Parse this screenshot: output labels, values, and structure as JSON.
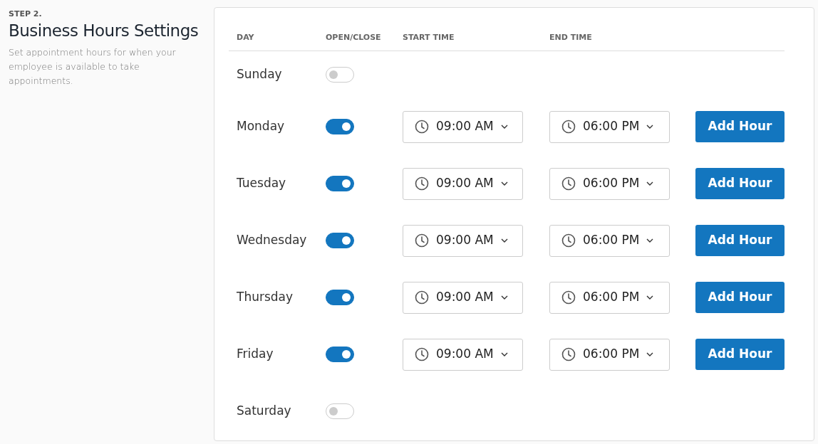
{
  "intro": {
    "step": "STEP 2.",
    "title": "Business Hours Settings",
    "description": "Set appointment hours for when your employee is available to take appointments."
  },
  "columns": [
    "DAY",
    "OPEN/CLOSE",
    "START TIME",
    "END TIME"
  ],
  "days": [
    {
      "day": "Sunday",
      "open": false
    },
    {
      "day": "Monday",
      "open": true,
      "start": "09:00 AM",
      "end": "06:00 PM",
      "button": "Add Hour"
    },
    {
      "day": "Tuesday",
      "open": true,
      "start": "09:00 AM",
      "end": "06:00 PM",
      "button": "Add Hour"
    },
    {
      "day": "Wednesday",
      "open": true,
      "start": "09:00 AM",
      "end": "06:00 PM",
      "button": "Add Hour"
    },
    {
      "day": "Thursday",
      "open": true,
      "start": "09:00 AM",
      "end": "06:00 PM",
      "button": "Add Hour"
    },
    {
      "day": "Friday",
      "open": true,
      "start": "09:00 AM",
      "end": "06:00 PM",
      "button": "Add Hour"
    },
    {
      "day": "Saturday",
      "open": false
    }
  ]
}
